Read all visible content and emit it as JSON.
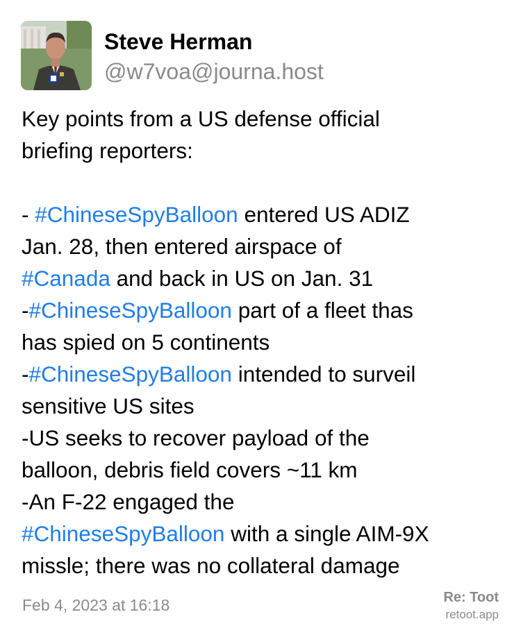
{
  "author": {
    "name": "Steve Herman",
    "handle": "@w7voa@journa.host",
    "avatar_icon": "reporter-photo-avatar"
  },
  "post": {
    "lines": [
      [
        {
          "text": "Key points from a US defense official"
        }
      ],
      [
        {
          "text": "briefing reporters:"
        }
      ],
      [],
      [
        {
          "text": "- "
        },
        {
          "text": "#ChineseSpyBalloon",
          "tag": true
        },
        {
          "text": " entered US ADIZ"
        }
      ],
      [
        {
          "text": "Jan. 28, then entered airspace of"
        }
      ],
      [
        {
          "text": "#Canada",
          "tag": true
        },
        {
          "text": " and back in US on Jan. 31"
        }
      ],
      [
        {
          "text": "-"
        },
        {
          "text": "#ChineseSpyBalloon",
          "tag": true
        },
        {
          "text": " part of a fleet thas"
        }
      ],
      [
        {
          "text": "has spied on 5 continents"
        }
      ],
      [
        {
          "text": "-"
        },
        {
          "text": "#ChineseSpyBalloon",
          "tag": true
        },
        {
          "text": " intended to surveil"
        }
      ],
      [
        {
          "text": "sensitive US sites"
        }
      ],
      [
        {
          "text": "-US seeks to recover payload of the"
        }
      ],
      [
        {
          "text": "balloon, debris field covers ~11 km"
        }
      ],
      [
        {
          "text": "-An F-22 engaged the"
        }
      ],
      [
        {
          "text": "#ChineseSpyBalloon",
          "tag": true
        },
        {
          "text": " with a single AIM-9X"
        }
      ],
      [
        {
          "text": "missle; there was no collateral damage"
        }
      ]
    ]
  },
  "timestamp": "Feb 4, 2023 at 16:18",
  "brand": {
    "title": "Re: Toot",
    "subtitle": "retoot.app"
  },
  "colors": {
    "hashtag": "#1f7de6",
    "secondary_text": "#8a8a8e"
  }
}
